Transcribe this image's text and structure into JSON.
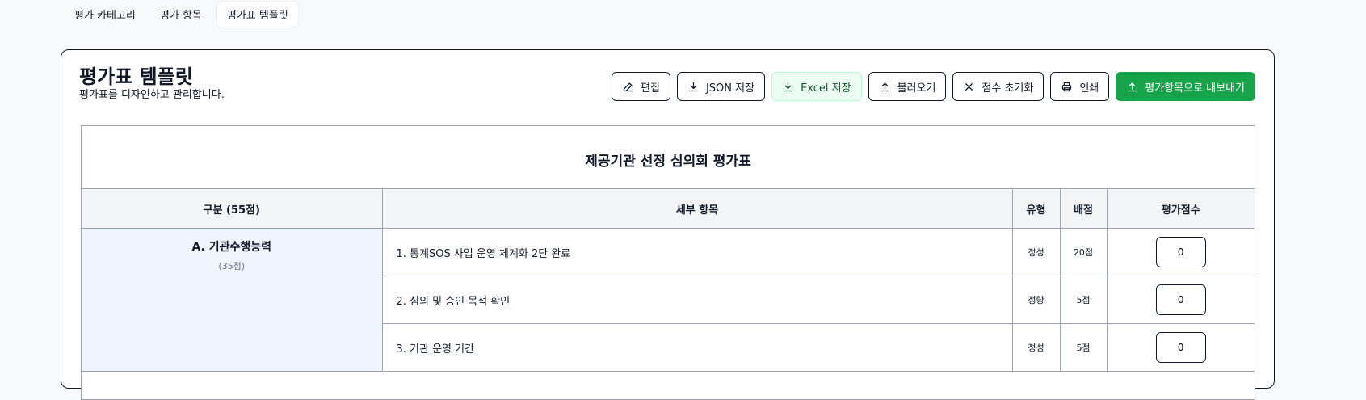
{
  "tabs": [
    {
      "label": "평가 카테고리"
    },
    {
      "label": "평가 항목"
    },
    {
      "label": "평가표 템플릿"
    }
  ],
  "page": {
    "title": "평가표 템플릿",
    "subtitle": "평가표를 디자인하고 관리합니다."
  },
  "toolbar": {
    "edit": "편집",
    "json_save": "JSON 저장",
    "excel_save": "Excel 저장",
    "load": "불러오기",
    "reset_scores": "점수 초기화",
    "print": "인쇄",
    "export": "평가항목으로 내보내기"
  },
  "sheet": {
    "title": "제공기관 선정 심의회 평가표",
    "headers": {
      "category": "구분 (55점)",
      "detail": "세부 항목",
      "type": "유형",
      "points": "배점",
      "score": "평가점수"
    },
    "category": {
      "name": "A. 기관수행능력",
      "score": "(35점)"
    },
    "rows": [
      {
        "item": "1. 통계SOS 사업 운영 체계화 2단 완료",
        "type": "정성",
        "points": "20점",
        "score": "0"
      },
      {
        "item": "2. 심의 및 승인 목적 확인",
        "type": "정량",
        "points": "5점",
        "score": "0"
      },
      {
        "item": "3. 기관 운영 기간",
        "type": "정성",
        "points": "5점",
        "score": "0"
      }
    ]
  },
  "colors": {
    "primary": "#16a34a",
    "excel_bg": "#ecfdf3",
    "category_bg": "#eef5ff"
  }
}
